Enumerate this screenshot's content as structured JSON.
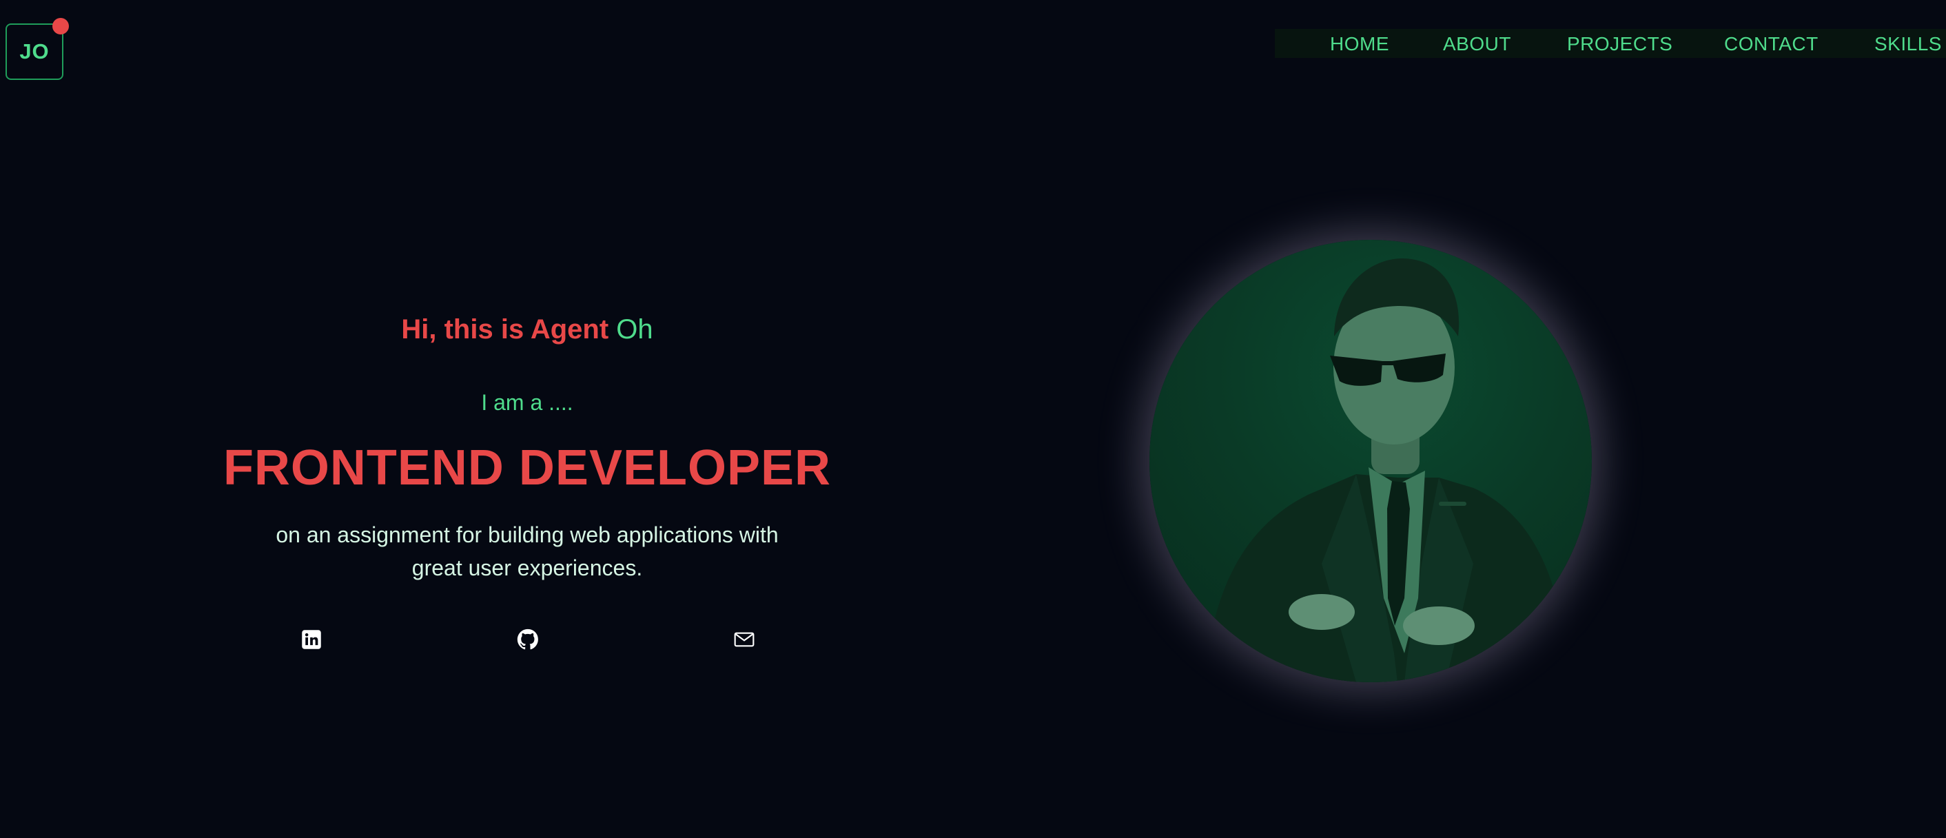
{
  "logo": {
    "text": "JO"
  },
  "nav": {
    "items": [
      {
        "label": "HOME"
      },
      {
        "label": "ABOUT"
      },
      {
        "label": "PROJECTS"
      },
      {
        "label": "CONTACT"
      },
      {
        "label": "SKILLS"
      }
    ]
  },
  "hero": {
    "greeting_prefix": "Hi, this is Agent ",
    "greeting_name": "Oh",
    "intro": "I am a ....",
    "role": "FRONTEND DEVELOPER",
    "description_line1": "on an assignment for building web applications with",
    "description_line2": "great user experiences."
  },
  "social": [
    {
      "icon": "linkedin-icon"
    },
    {
      "icon": "github-icon"
    },
    {
      "icon": "mail-icon"
    }
  ],
  "colors": {
    "background": "#050812",
    "accent_green": "#4fdc8c",
    "accent_red": "#e84848",
    "portrait_tint": "#0a3a26"
  }
}
